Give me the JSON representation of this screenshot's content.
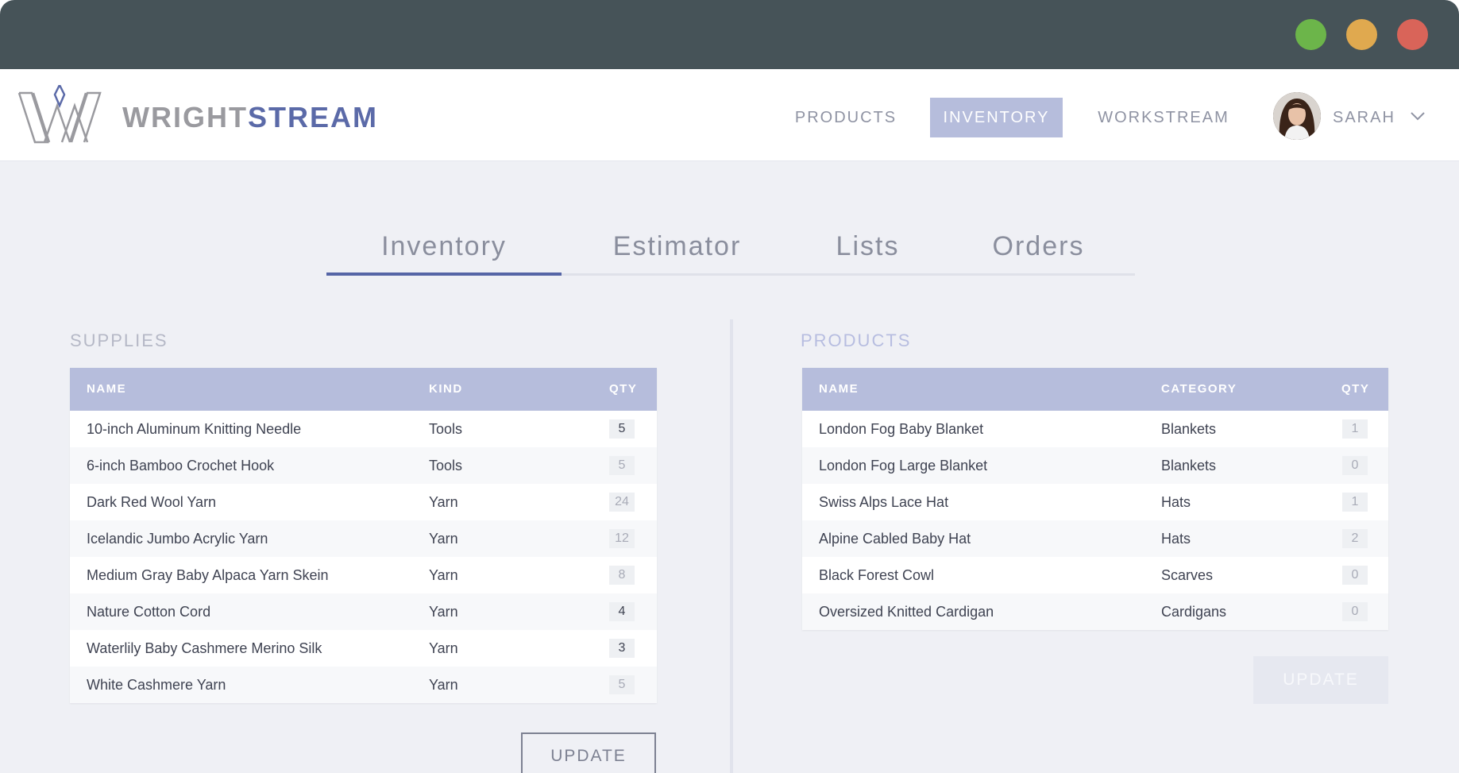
{
  "brand": {
    "part1": "WRIGHT",
    "part2": "STREAM"
  },
  "nav": {
    "items": [
      {
        "label": "PRODUCTS"
      },
      {
        "label": "INVENTORY"
      },
      {
        "label": "WORKSTREAM"
      }
    ],
    "user": "SARAH"
  },
  "tabs": [
    {
      "label": "Inventory"
    },
    {
      "label": "Estimator"
    },
    {
      "label": "Lists"
    },
    {
      "label": "Orders"
    }
  ],
  "supplies": {
    "title": "SUPPLIES",
    "columns": [
      "NAME",
      "KIND",
      "QTY"
    ],
    "rows": [
      {
        "name": "10-inch Aluminum Knitting Needle",
        "kind": "Tools",
        "qty": "5"
      },
      {
        "name": "6-inch Bamboo Crochet Hook",
        "kind": "Tools",
        "qty": "5"
      },
      {
        "name": "Dark Red Wool Yarn",
        "kind": "Yarn",
        "qty": "24"
      },
      {
        "name": "Icelandic Jumbo Acrylic Yarn",
        "kind": "Yarn",
        "qty": "12"
      },
      {
        "name": "Medium Gray Baby Alpaca Yarn Skein",
        "kind": "Yarn",
        "qty": "8"
      },
      {
        "name": "Nature Cotton Cord",
        "kind": "Yarn",
        "qty": "4"
      },
      {
        "name": "Waterlily Baby Cashmere Merino Silk",
        "kind": "Yarn",
        "qty": "3"
      },
      {
        "name": "White Cashmere Yarn",
        "kind": "Yarn",
        "qty": "5"
      }
    ],
    "update_label": "UPDATE"
  },
  "products": {
    "title": "PRODUCTS",
    "columns": [
      "NAME",
      "CATEGORY",
      "QTY"
    ],
    "rows": [
      {
        "name": "London Fog Baby Blanket",
        "category": "Blankets",
        "qty": "1"
      },
      {
        "name": "London Fog Large Blanket",
        "category": "Blankets",
        "qty": "0"
      },
      {
        "name": "Swiss Alps Lace Hat",
        "category": "Hats",
        "qty": "1"
      },
      {
        "name": "Alpine Cabled Baby Hat",
        "category": "Hats",
        "qty": "2"
      },
      {
        "name": "Black Forest Cowl",
        "category": "Scarves",
        "qty": "0"
      },
      {
        "name": "Oversized Knitted Cardigan",
        "category": "Cardigans",
        "qty": "0"
      }
    ],
    "update_label": "UPDATE"
  },
  "colors": {
    "titlebar": "#465358",
    "accent": "#5565a6",
    "header_row": "#b6bddc",
    "traffic_green": "#6cb54a",
    "traffic_yellow": "#e0a94f",
    "traffic_red": "#d96459"
  },
  "icons": [
    "wrightstream-logo-icon",
    "chevron-down-icon",
    "avatar"
  ]
}
